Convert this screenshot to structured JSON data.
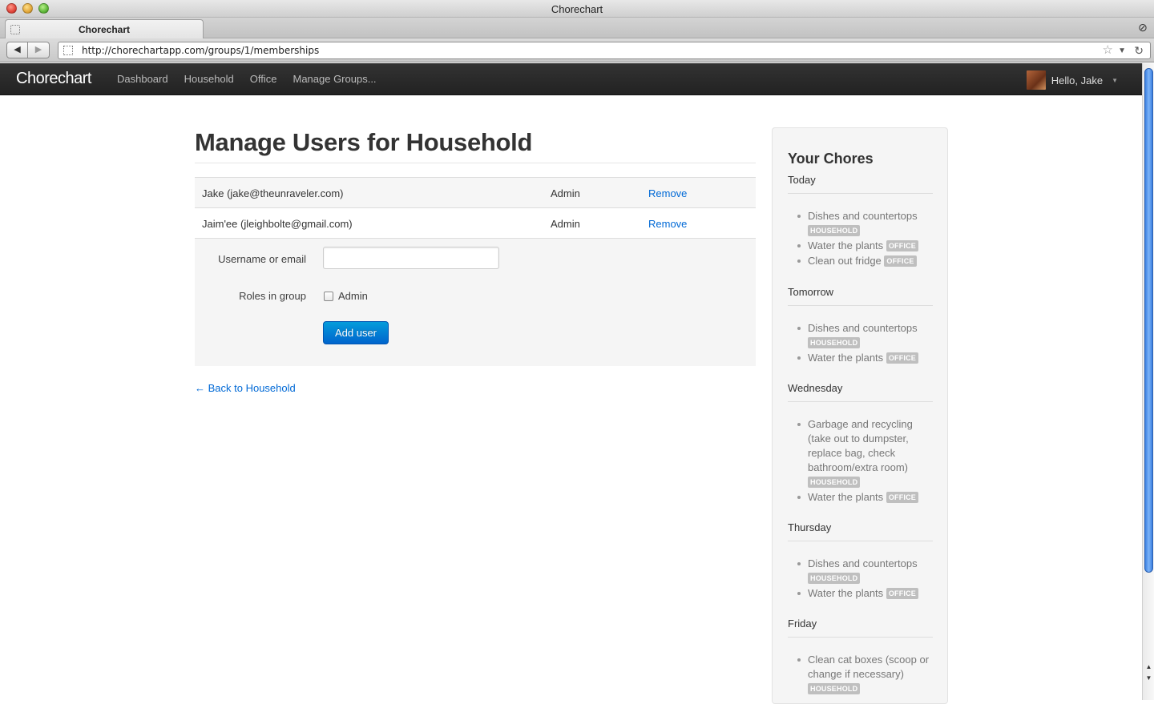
{
  "window": {
    "title": "Chorechart"
  },
  "tab": {
    "label": "Chorechart"
  },
  "address_bar": {
    "url": "http://chorechartapp.com/groups/1/memberships"
  },
  "navbar": {
    "brand": "Chorechart",
    "links": [
      "Dashboard",
      "Household",
      "Office",
      "Manage Groups..."
    ],
    "user_greeting": "Hello, Jake"
  },
  "main": {
    "title": "Manage Users for Household",
    "members": [
      {
        "name": "Jake (jake@theunraveler.com)",
        "role": "Admin",
        "action": "Remove"
      },
      {
        "name": "Jaim'ee (jleighbolte@gmail.com)",
        "role": "Admin",
        "action": "Remove"
      }
    ],
    "form": {
      "username_label": "Username or email",
      "username_value": "",
      "roles_label": "Roles in group",
      "admin_checkbox_label": "Admin",
      "admin_checked": false,
      "submit_label": "Add user"
    },
    "back_link": "← Back to Household"
  },
  "sidebar": {
    "title": "Your Chores",
    "days": [
      {
        "name": "Today",
        "chores": [
          {
            "text": "Dishes and countertops",
            "group": "HOUSEHOLD"
          },
          {
            "text": "Water the plants",
            "group": "OFFICE"
          },
          {
            "text": "Clean out fridge",
            "group": "OFFICE"
          }
        ]
      },
      {
        "name": "Tomorrow",
        "chores": [
          {
            "text": "Dishes and countertops",
            "group": "HOUSEHOLD"
          },
          {
            "text": "Water the plants",
            "group": "OFFICE"
          }
        ]
      },
      {
        "name": "Wednesday",
        "chores": [
          {
            "text": "Garbage and recycling (take out to dumpster, replace bag, check bathroom/extra room)",
            "group": "HOUSEHOLD"
          },
          {
            "text": "Water the plants",
            "group": "OFFICE"
          }
        ]
      },
      {
        "name": "Thursday",
        "chores": [
          {
            "text": "Dishes and countertops",
            "group": "HOUSEHOLD"
          },
          {
            "text": "Water the plants",
            "group": "OFFICE"
          }
        ]
      },
      {
        "name": "Friday",
        "chores": [
          {
            "text": "Clean cat boxes (scoop or change if necessary)",
            "group": "HOUSEHOLD"
          }
        ]
      }
    ]
  },
  "colors": {
    "link": "#0069d6",
    "primary_button": "#0064cd",
    "navbar": "#222222",
    "badge": "#bfbfbf"
  }
}
